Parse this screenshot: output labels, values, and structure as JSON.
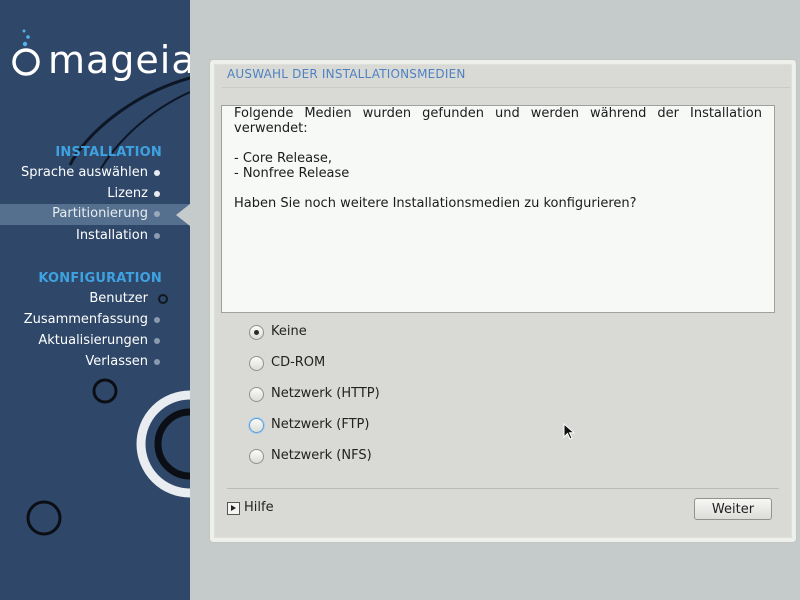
{
  "brand": {
    "logo_text": "mageia"
  },
  "sidebar": {
    "sections": [
      {
        "title": "INSTALLATION",
        "items": [
          {
            "label": "Sprache auswählen",
            "state": "done"
          },
          {
            "label": "Lizenz",
            "state": "done"
          },
          {
            "label": "Partitionierung",
            "state": "active"
          },
          {
            "label": "Installation",
            "state": "future"
          }
        ]
      },
      {
        "title": "KONFIGURATION",
        "items": [
          {
            "label": "Benutzer",
            "state": "future"
          },
          {
            "label": "Zusammenfassung",
            "state": "future"
          },
          {
            "label": "Aktualisierungen",
            "state": "future"
          },
          {
            "label": "Verlassen",
            "state": "future"
          }
        ]
      }
    ]
  },
  "main": {
    "title": "AUSWAHL DER INSTALLATIONSMEDIEN",
    "info": {
      "intro": "Folgende Medien wurden gefunden und werden während der Installation verwendet:",
      "media": [
        "- Core Release,",
        "- Nonfree Release"
      ],
      "question": "Haben Sie noch weitere Installationsmedien zu konfigurieren?"
    },
    "options": [
      {
        "label": "Keine",
        "checked": true
      },
      {
        "label": "CD-ROM",
        "checked": false
      },
      {
        "label": "Netzwerk (HTTP)",
        "checked": false
      },
      {
        "label": "Netzwerk (FTP)",
        "checked": false,
        "focused": true
      },
      {
        "label": "Netzwerk (NFS)",
        "checked": false
      }
    ],
    "help_label": "Hilfe",
    "next_label": "Weiter"
  },
  "colors": {
    "sidebar_bg": "#2f4769",
    "section_title": "#3fa2e0",
    "page_title": "#4e82c2",
    "background": "#c5cacb"
  }
}
